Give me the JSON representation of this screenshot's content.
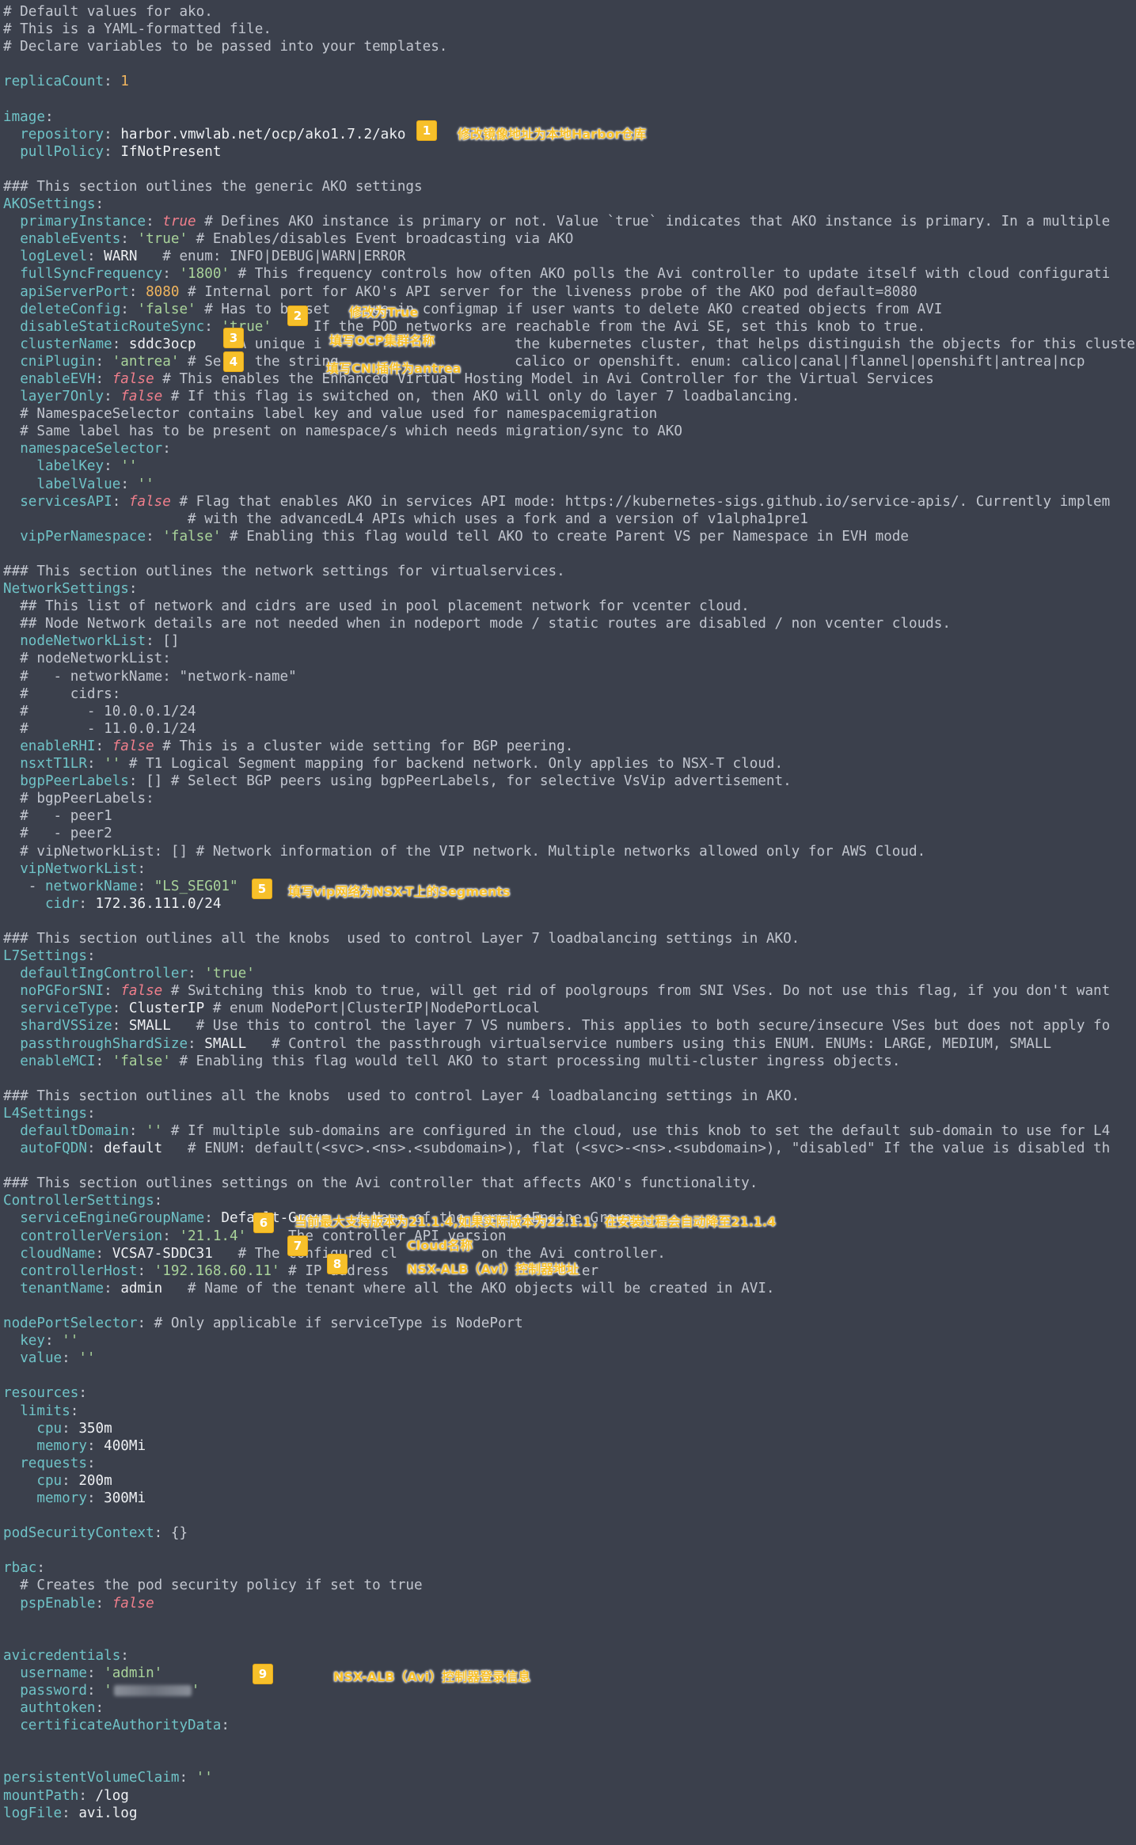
{
  "lines": [
    [
      [
        "c",
        "# Default values for ako."
      ]
    ],
    [
      [
        "c",
        "# This is a YAML-formatted file."
      ]
    ],
    [
      [
        "c",
        "# Declare variables to be passed into your templates."
      ]
    ],
    [],
    [
      [
        "kl",
        "replicaCount"
      ],
      [
        "p",
        ": "
      ],
      [
        "n",
        "1"
      ]
    ],
    [],
    [
      [
        "kl",
        "image"
      ],
      [
        "p",
        ":"
      ]
    ],
    [
      [
        "p",
        "  "
      ],
      [
        "k",
        "repository"
      ],
      [
        "p",
        ": "
      ],
      [
        "v",
        "harbor.vmwlab.net/ocp/ako1.7.2/ako"
      ]
    ],
    [
      [
        "p",
        "  "
      ],
      [
        "k",
        "pullPolicy"
      ],
      [
        "p",
        ": "
      ],
      [
        "v",
        "IfNotPresent"
      ]
    ],
    [],
    [
      [
        "c",
        "### This section outlines the generic AKO settings"
      ]
    ],
    [
      [
        "kl",
        "AKOSettings"
      ],
      [
        "p",
        ":"
      ]
    ],
    [
      [
        "p",
        "  "
      ],
      [
        "k",
        "primaryInstance"
      ],
      [
        "p",
        ": "
      ],
      [
        "b",
        "true"
      ],
      [
        "c",
        " # Defines AKO instance is primary or not. Value `true` indicates that AKO instance is primary. In a multiple"
      ]
    ],
    [
      [
        "p",
        "  "
      ],
      [
        "k",
        "enableEvents"
      ],
      [
        "p",
        ": "
      ],
      [
        "s",
        "'true'"
      ],
      [
        "c",
        " # Enables/disables Event broadcasting via AKO"
      ]
    ],
    [
      [
        "p",
        "  "
      ],
      [
        "k",
        "logLevel"
      ],
      [
        "p",
        ": "
      ],
      [
        "v",
        "WARN"
      ],
      [
        "c",
        "   # enum: INFO|DEBUG|WARN|ERROR"
      ]
    ],
    [
      [
        "p",
        "  "
      ],
      [
        "k",
        "fullSyncFrequency"
      ],
      [
        "p",
        ": "
      ],
      [
        "s",
        "'1800'"
      ],
      [
        "c",
        " # This frequency controls how often AKO polls the Avi controller to update itself with cloud configurati"
      ]
    ],
    [
      [
        "p",
        "  "
      ],
      [
        "k",
        "apiServerPort"
      ],
      [
        "p",
        ": "
      ],
      [
        "n",
        "8080"
      ],
      [
        "c",
        " # Internal port for AKO's API server for the liveness probe of the AKO pod default=8080"
      ]
    ],
    [
      [
        "p",
        "  "
      ],
      [
        "k",
        "deleteConfig"
      ],
      [
        "p",
        ": "
      ],
      [
        "s",
        "'false'"
      ],
      [
        "c",
        " # Has to be set     ue in configmap if user wants to delete AKO created objects from AVI"
      ]
    ],
    [
      [
        "p",
        "  "
      ],
      [
        "k",
        "disableStaticRouteSync"
      ],
      [
        "p",
        ": "
      ],
      [
        "s",
        "'true'"
      ],
      [
        "c",
        "     If the POD networks are reachable from the Avi SE, set this knob to true."
      ]
    ],
    [
      [
        "p",
        "  "
      ],
      [
        "k",
        "clusterName"
      ],
      [
        "p",
        ": "
      ],
      [
        "v",
        "sddc3ocp"
      ],
      [
        "c",
        "     A unique i                       the kubernetes cluster, that helps distinguish the objects for this cluster in t"
      ]
    ],
    [
      [
        "p",
        "  "
      ],
      [
        "k",
        "cniPlugin"
      ],
      [
        "p",
        ": "
      ],
      [
        "s",
        "'antrea'"
      ],
      [
        "c",
        " # Se    the string                     calico or openshift. enum: calico|canal|flannel|openshift|antrea|ncp"
      ]
    ],
    [
      [
        "p",
        "  "
      ],
      [
        "k",
        "enableEVH"
      ],
      [
        "p",
        ": "
      ],
      [
        "b",
        "false"
      ],
      [
        "c",
        " # This enables the Enhanced Virtual Hosting Model in Avi Controller for the Virtual Services"
      ]
    ],
    [
      [
        "p",
        "  "
      ],
      [
        "k",
        "layer7Only"
      ],
      [
        "p",
        ": "
      ],
      [
        "b",
        "false"
      ],
      [
        "c",
        " # If this flag is switched on, then AKO will only do layer 7 loadbalancing."
      ]
    ],
    [
      [
        "c",
        "  # NamespaceSelector contains label key and value used for namespacemigration"
      ]
    ],
    [
      [
        "c",
        "  # Same label has to be present on namespace/s which needs migration/sync to AKO"
      ]
    ],
    [
      [
        "p",
        "  "
      ],
      [
        "k",
        "namespaceSelector"
      ],
      [
        "p",
        ":"
      ]
    ],
    [
      [
        "p",
        "    "
      ],
      [
        "k",
        "labelKey"
      ],
      [
        "p",
        ": "
      ],
      [
        "s",
        "''"
      ]
    ],
    [
      [
        "p",
        "    "
      ],
      [
        "k",
        "labelValue"
      ],
      [
        "p",
        ": "
      ],
      [
        "s",
        "''"
      ]
    ],
    [
      [
        "p",
        "  "
      ],
      [
        "k",
        "servicesAPI"
      ],
      [
        "p",
        ": "
      ],
      [
        "b",
        "false"
      ],
      [
        "c",
        " # Flag that enables AKO in services API mode: https://kubernetes-sigs.github.io/service-apis/. Currently implem"
      ]
    ],
    [
      [
        "c",
        "                      # with the advancedL4 APIs which uses a fork and a version of v1alpha1pre1"
      ]
    ],
    [
      [
        "p",
        "  "
      ],
      [
        "k",
        "vipPerNamespace"
      ],
      [
        "p",
        ": "
      ],
      [
        "s",
        "'false'"
      ],
      [
        "c",
        " # Enabling this flag would tell AKO to create Parent VS per Namespace in EVH mode"
      ]
    ],
    [],
    [
      [
        "c",
        "### This section outlines the network settings for virtualservices."
      ]
    ],
    [
      [
        "kl",
        "NetworkSettings"
      ],
      [
        "p",
        ":"
      ]
    ],
    [
      [
        "c",
        "  ## This list of network and cidrs are used in pool placement network for vcenter cloud."
      ]
    ],
    [
      [
        "c",
        "  ## Node Network details are not needed when in nodeport mode / static routes are disabled / non vcenter clouds."
      ]
    ],
    [
      [
        "p",
        "  "
      ],
      [
        "k",
        "nodeNetworkList"
      ],
      [
        "p",
        ": []"
      ]
    ],
    [
      [
        "c",
        "  # nodeNetworkList:"
      ]
    ],
    [
      [
        "c",
        "  #   - networkName: \"network-name\""
      ]
    ],
    [
      [
        "c",
        "  #     cidrs:"
      ]
    ],
    [
      [
        "c",
        "  #       - 10.0.0.1/24"
      ]
    ],
    [
      [
        "c",
        "  #       - 11.0.0.1/24"
      ]
    ],
    [
      [
        "p",
        "  "
      ],
      [
        "k",
        "enableRHI"
      ],
      [
        "p",
        ": "
      ],
      [
        "b",
        "false"
      ],
      [
        "c",
        " # This is a cluster wide setting for BGP peering."
      ]
    ],
    [
      [
        "p",
        "  "
      ],
      [
        "k",
        "nsxtT1LR"
      ],
      [
        "p",
        ": "
      ],
      [
        "s",
        "''"
      ],
      [
        "c",
        " # T1 Logical Segment mapping for backend network. Only applies to NSX-T cloud."
      ]
    ],
    [
      [
        "p",
        "  "
      ],
      [
        "k",
        "bgpPeerLabels"
      ],
      [
        "p",
        ": []"
      ],
      [
        "c",
        " # Select BGP peers using bgpPeerLabels, for selective VsVip advertisement."
      ]
    ],
    [
      [
        "c",
        "  # bgpPeerLabels:"
      ]
    ],
    [
      [
        "c",
        "  #   - peer1"
      ]
    ],
    [
      [
        "c",
        "  #   - peer2"
      ]
    ],
    [
      [
        "c",
        "  # vipNetworkList: [] # Network information of the VIP network. Multiple networks allowed only for AWS Cloud."
      ]
    ],
    [
      [
        "p",
        "  "
      ],
      [
        "k",
        "vipNetworkList"
      ],
      [
        "p",
        ":"
      ]
    ],
    [
      [
        "p",
        "   - "
      ],
      [
        "k",
        "networkName"
      ],
      [
        "p",
        ": "
      ],
      [
        "s",
        "\"LS_SEG01\""
      ]
    ],
    [
      [
        "p",
        "     "
      ],
      [
        "k",
        "cidr"
      ],
      [
        "p",
        ": "
      ],
      [
        "v",
        "172.36.111.0/24"
      ]
    ],
    [],
    [
      [
        "c",
        "### This section outlines all the knobs  used to control Layer 7 loadbalancing settings in AKO."
      ]
    ],
    [
      [
        "kl",
        "L7Settings"
      ],
      [
        "p",
        ":"
      ]
    ],
    [
      [
        "p",
        "  "
      ],
      [
        "k",
        "defaultIngController"
      ],
      [
        "p",
        ": "
      ],
      [
        "s",
        "'true'"
      ]
    ],
    [
      [
        "p",
        "  "
      ],
      [
        "k",
        "noPGForSNI"
      ],
      [
        "p",
        ": "
      ],
      [
        "b",
        "false"
      ],
      [
        "c",
        " # Switching this knob to true, will get rid of poolgroups from SNI VSes. Do not use this flag, if you don't want"
      ]
    ],
    [
      [
        "p",
        "  "
      ],
      [
        "k",
        "serviceType"
      ],
      [
        "p",
        ": "
      ],
      [
        "v",
        "ClusterIP"
      ],
      [
        "c",
        " # enum NodePort|ClusterIP|NodePortLocal"
      ]
    ],
    [
      [
        "p",
        "  "
      ],
      [
        "k",
        "shardVSSize"
      ],
      [
        "p",
        ": "
      ],
      [
        "v",
        "SMALL"
      ],
      [
        "c",
        "   # Use this to control the layer 7 VS numbers. This applies to both secure/insecure VSes but does not apply fo"
      ]
    ],
    [
      [
        "p",
        "  "
      ],
      [
        "k",
        "passthroughShardSize"
      ],
      [
        "p",
        ": "
      ],
      [
        "v",
        "SMALL"
      ],
      [
        "c",
        "   # Control the passthrough virtualservice numbers using this ENUM. ENUMs: LARGE, MEDIUM, SMALL"
      ]
    ],
    [
      [
        "p",
        "  "
      ],
      [
        "k",
        "enableMCI"
      ],
      [
        "p",
        ": "
      ],
      [
        "s",
        "'false'"
      ],
      [
        "c",
        " # Enabling this flag would tell AKO to start processing multi-cluster ingress objects."
      ]
    ],
    [],
    [
      [
        "c",
        "### This section outlines all the knobs  used to control Layer 4 loadbalancing settings in AKO."
      ]
    ],
    [
      [
        "kl",
        "L4Settings"
      ],
      [
        "p",
        ":"
      ]
    ],
    [
      [
        "p",
        "  "
      ],
      [
        "k",
        "defaultDomain"
      ],
      [
        "p",
        ": "
      ],
      [
        "s",
        "''"
      ],
      [
        "c",
        " # If multiple sub-domains are configured in the cloud, use this knob to set the default sub-domain to use for L4"
      ]
    ],
    [
      [
        "p",
        "  "
      ],
      [
        "k",
        "autoFQDN"
      ],
      [
        "p",
        ": "
      ],
      [
        "v",
        "default"
      ],
      [
        "c",
        "   # ENUM: default(<svc>.<ns>.<subdomain>), flat (<svc>-<ns>.<subdomain>), \"disabled\" If the value is disabled th"
      ]
    ],
    [],
    [
      [
        "c",
        "### This section outlines settings on the Avi controller that affects AKO's functionality."
      ]
    ],
    [
      [
        "kl",
        "ControllerSettings"
      ],
      [
        "p",
        ":"
      ]
    ],
    [
      [
        "p",
        "  "
      ],
      [
        "k",
        "serviceEngineGroupName"
      ],
      [
        "p",
        ": "
      ],
      [
        "v",
        "Default-Group"
      ],
      [
        "c",
        "   # Name of the ServiceEngine Group."
      ]
    ],
    [
      [
        "p",
        "  "
      ],
      [
        "k",
        "controllerVersion"
      ],
      [
        "p",
        ": "
      ],
      [
        "s",
        "'21.1.4'"
      ],
      [
        "c",
        "     The controller API version"
      ]
    ],
    [
      [
        "p",
        "  "
      ],
      [
        "k",
        "cloudName"
      ],
      [
        "p",
        ": "
      ],
      [
        "v",
        "VCSA7-SDDC31"
      ],
      [
        "c",
        "   # The configured cl          on the Avi controller."
      ]
    ],
    [
      [
        "p",
        "  "
      ],
      [
        "k",
        "controllerHost"
      ],
      [
        "p",
        ": "
      ],
      [
        "s",
        "'192.168.60.11'"
      ],
      [
        "c",
        " # IP address                  troller"
      ]
    ],
    [
      [
        "p",
        "  "
      ],
      [
        "k",
        "tenantName"
      ],
      [
        "p",
        ": "
      ],
      [
        "v",
        "admin"
      ],
      [
        "c",
        "   # Name of the tenant where all the AKO objects will be created in AVI."
      ]
    ],
    [],
    [
      [
        "kl",
        "nodePortSelector"
      ],
      [
        "p",
        ": "
      ],
      [
        "c",
        "# Only applicable if serviceType is NodePort"
      ]
    ],
    [
      [
        "p",
        "  "
      ],
      [
        "k",
        "key"
      ],
      [
        "p",
        ": "
      ],
      [
        "s",
        "''"
      ]
    ],
    [
      [
        "p",
        "  "
      ],
      [
        "k",
        "value"
      ],
      [
        "p",
        ": "
      ],
      [
        "s",
        "''"
      ]
    ],
    [],
    [
      [
        "kl",
        "resources"
      ],
      [
        "p",
        ":"
      ]
    ],
    [
      [
        "p",
        "  "
      ],
      [
        "k",
        "limits"
      ],
      [
        "p",
        ":"
      ]
    ],
    [
      [
        "p",
        "    "
      ],
      [
        "k",
        "cpu"
      ],
      [
        "p",
        ": "
      ],
      [
        "v",
        "350m"
      ]
    ],
    [
      [
        "p",
        "    "
      ],
      [
        "k",
        "memory"
      ],
      [
        "p",
        ": "
      ],
      [
        "v",
        "400Mi"
      ]
    ],
    [
      [
        "p",
        "  "
      ],
      [
        "k",
        "requests"
      ],
      [
        "p",
        ":"
      ]
    ],
    [
      [
        "p",
        "    "
      ],
      [
        "k",
        "cpu"
      ],
      [
        "p",
        ": "
      ],
      [
        "v",
        "200m"
      ]
    ],
    [
      [
        "p",
        "    "
      ],
      [
        "k",
        "memory"
      ],
      [
        "p",
        ": "
      ],
      [
        "v",
        "300Mi"
      ]
    ],
    [],
    [
      [
        "kl",
        "podSecurityContext"
      ],
      [
        "p",
        ": {}"
      ]
    ],
    [],
    [
      [
        "kl",
        "rbac"
      ],
      [
        "p",
        ":"
      ]
    ],
    [
      [
        "c",
        "  # Creates the pod security policy if set to true"
      ]
    ],
    [
      [
        "p",
        "  "
      ],
      [
        "k",
        "pspEnable"
      ],
      [
        "p",
        ": "
      ],
      [
        "b",
        "false"
      ]
    ],
    [],
    [],
    [
      [
        "kl",
        "avicredentials"
      ],
      [
        "p",
        ":"
      ]
    ],
    [
      [
        "p",
        "  "
      ],
      [
        "k",
        "username"
      ],
      [
        "p",
        ": "
      ],
      [
        "s",
        "'admin'"
      ]
    ],
    [
      [
        "p",
        "  "
      ],
      [
        "k",
        "password"
      ],
      [
        "p",
        ": "
      ],
      [
        "s",
        "'"
      ],
      [
        "blur",
        ""
      ],
      [
        "s",
        "'"
      ]
    ],
    [
      [
        "p",
        "  "
      ],
      [
        "k",
        "authtoken"
      ],
      [
        "p",
        ":"
      ]
    ],
    [
      [
        "p",
        "  "
      ],
      [
        "k",
        "certificateAuthorityData"
      ],
      [
        "p",
        ":"
      ]
    ],
    [],
    [],
    [
      [
        "kl",
        "persistentVolumeClaim"
      ],
      [
        "p",
        ": "
      ],
      [
        "s",
        "''"
      ]
    ],
    [
      [
        "kl",
        "mountPath"
      ],
      [
        "p",
        ": "
      ],
      [
        "v",
        "/log"
      ]
    ],
    [
      [
        "kl",
        "logFile"
      ],
      [
        "p",
        ": "
      ],
      [
        "v",
        "avi.log"
      ]
    ]
  ],
  "annotations": [
    {
      "num": "1",
      "text": "修改镜像地址为本地Harbor仓库"
    },
    {
      "num": "2",
      "text": "修改为True"
    },
    {
      "num": "3",
      "text": "填写OCP集群名称"
    },
    {
      "num": "4",
      "text": "填写CNI插件为antrea"
    },
    {
      "num": "5",
      "text": "填写vip网络为NSX-T上的Segments"
    },
    {
      "num": "6",
      "text": "当前最大支持版本为21.1.4,如果实际版本为22.1.1，在安装过程会自动降至21.1.4"
    },
    {
      "num": "7",
      "text": "Cloud名称"
    },
    {
      "num": "8",
      "text": "NSX-ALB（Avi）控制器地址"
    },
    {
      "num": "9",
      "text": "NSX-ALB（Avi）控制器登录信息"
    }
  ]
}
